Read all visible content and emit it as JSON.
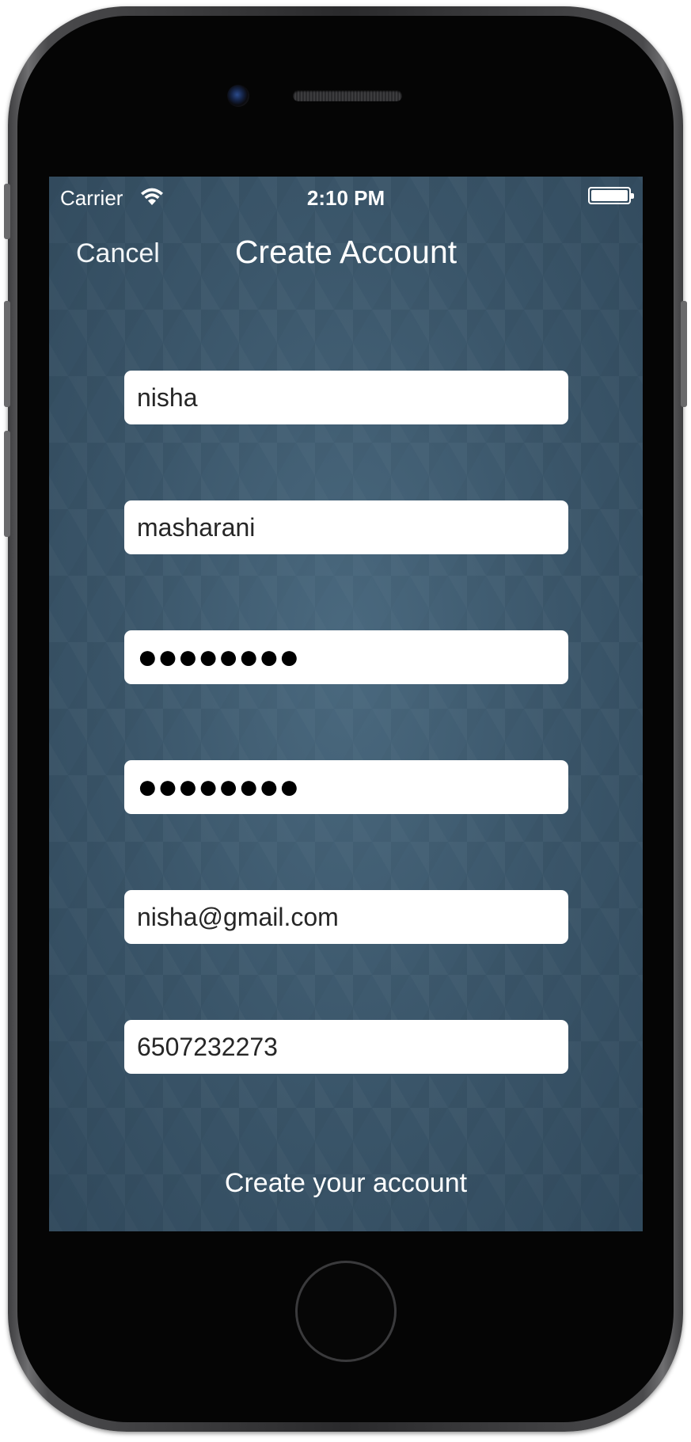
{
  "status_bar": {
    "carrier": "Carrier",
    "time": "2:10 PM",
    "wifi_icon": "wifi-icon",
    "battery_icon": "battery-icon"
  },
  "nav": {
    "cancel_label": "Cancel",
    "title": "Create Account"
  },
  "form": {
    "first_name": "nisha",
    "last_name": "masharani",
    "password": "●●●●●●●●",
    "confirm_password": "●●●●●●●●",
    "email": "nisha@gmail.com",
    "phone": "6507232273"
  },
  "footer": {
    "create_label": "Create your account"
  },
  "colors": {
    "background": "#3a5569",
    "field_background": "#ffffff",
    "text_light": "#ffffff"
  }
}
